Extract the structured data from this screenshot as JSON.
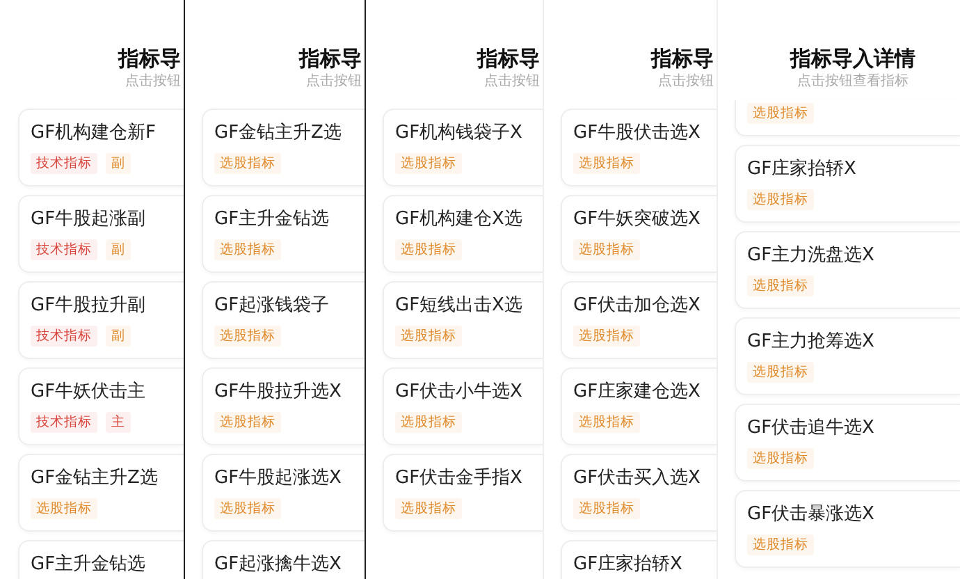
{
  "panels": [
    {
      "title": "指标导",
      "subtitle": "点击按钮",
      "cards": [
        {
          "name": "GF机构建仓新F",
          "tags": [
            {
              "label": "技术指标",
              "color": "#d9453b"
            },
            {
              "label": "副",
              "color": "#e08a2a"
            }
          ]
        },
        {
          "name": "GF牛股起涨副",
          "tags": [
            {
              "label": "技术指标",
              "color": "#d9453b"
            },
            {
              "label": "副",
              "color": "#e08a2a"
            }
          ]
        },
        {
          "name": "GF牛股拉升副",
          "tags": [
            {
              "label": "技术指标",
              "color": "#d9453b"
            },
            {
              "label": "副",
              "color": "#e08a2a"
            }
          ]
        },
        {
          "name": "GF牛妖伏击主",
          "tags": [
            {
              "label": "技术指标",
              "color": "#d9453b"
            },
            {
              "label": "主",
              "color": "#d9453b"
            }
          ]
        },
        {
          "name": "GF金钻主升Z选",
          "tags": [
            {
              "label": "选股指标",
              "color": "#e08a2a"
            }
          ]
        },
        {
          "name": "GF主升金钻选"
        }
      ]
    },
    {
      "title": "指标导",
      "subtitle": "点击按钮",
      "cards": [
        {
          "name": "GF金钻主升Z选",
          "tags": [
            {
              "label": "选股指标",
              "color": "#e08a2a"
            }
          ]
        },
        {
          "name": "GF主升金钻选",
          "tags": [
            {
              "label": "选股指标",
              "color": "#e08a2a"
            }
          ]
        },
        {
          "name": "GF起涨钱袋子",
          "tags": [
            {
              "label": "选股指标",
              "color": "#e08a2a"
            }
          ]
        },
        {
          "name": "GF牛股拉升选X",
          "tags": [
            {
              "label": "选股指标",
              "color": "#e08a2a"
            }
          ]
        },
        {
          "name": "GF牛股起涨选X",
          "tags": [
            {
              "label": "选股指标",
              "color": "#e08a2a"
            }
          ]
        },
        {
          "name": "GF起涨擒牛选X"
        }
      ]
    },
    {
      "title": "指标导",
      "subtitle": "点击按钮",
      "cards": [
        {
          "name": "GF机构钱袋子X",
          "tags": [
            {
              "label": "选股指标",
              "color": "#e08a2a"
            }
          ]
        },
        {
          "name": "GF机构建仓X选",
          "tags": [
            {
              "label": "选股指标",
              "color": "#e08a2a"
            }
          ]
        },
        {
          "name": "GF短线出击X选",
          "tags": [
            {
              "label": "选股指标",
              "color": "#e08a2a"
            }
          ]
        },
        {
          "name": "GF伏击小牛选X",
          "tags": [
            {
              "label": "选股指标",
              "color": "#e08a2a"
            }
          ]
        },
        {
          "name": "GF伏击金手指X",
          "tags": [
            {
              "label": "选股指标",
              "color": "#e08a2a"
            }
          ]
        }
      ]
    },
    {
      "title": "指标导",
      "subtitle": "点击按钮",
      "cards": [
        {
          "name": "GF牛股伏击选X",
          "tags": [
            {
              "label": "选股指标",
              "color": "#e08a2a"
            }
          ]
        },
        {
          "name": "GF牛妖突破选X",
          "tags": [
            {
              "label": "选股指标",
              "color": "#e08a2a"
            }
          ]
        },
        {
          "name": "GF伏击加仓选X",
          "tags": [
            {
              "label": "选股指标",
              "color": "#e08a2a"
            }
          ]
        },
        {
          "name": "GF庄家建仓选X",
          "tags": [
            {
              "label": "选股指标",
              "color": "#e08a2a"
            }
          ]
        },
        {
          "name": "GF伏击买入选X",
          "tags": [
            {
              "label": "选股指标",
              "color": "#e08a2a"
            }
          ]
        },
        {
          "name": "GF庄家抬轿X"
        }
      ]
    },
    {
      "title": "指标导入详情",
      "subtitle": "点击按钮查看指标",
      "cards": [
        {
          "tags": [
            {
              "label": "选股指标",
              "color": "#e08a2a"
            }
          ]
        },
        {
          "name": "GF庄家抬轿X",
          "tags": [
            {
              "label": "选股指标",
              "color": "#e08a2a"
            }
          ]
        },
        {
          "name": "GF主力洗盘选X",
          "tags": [
            {
              "label": "选股指标",
              "color": "#e08a2a"
            }
          ]
        },
        {
          "name": "GF主力抢筹选X",
          "tags": [
            {
              "label": "选股指标",
              "color": "#e08a2a"
            }
          ]
        },
        {
          "name": "GF伏击追牛选X",
          "tags": [
            {
              "label": "选股指标",
              "color": "#e08a2a"
            }
          ]
        },
        {
          "name": "GF伏击暴涨选X",
          "tags": [
            {
              "label": "选股指标",
              "color": "#e08a2a"
            }
          ]
        }
      ]
    }
  ]
}
